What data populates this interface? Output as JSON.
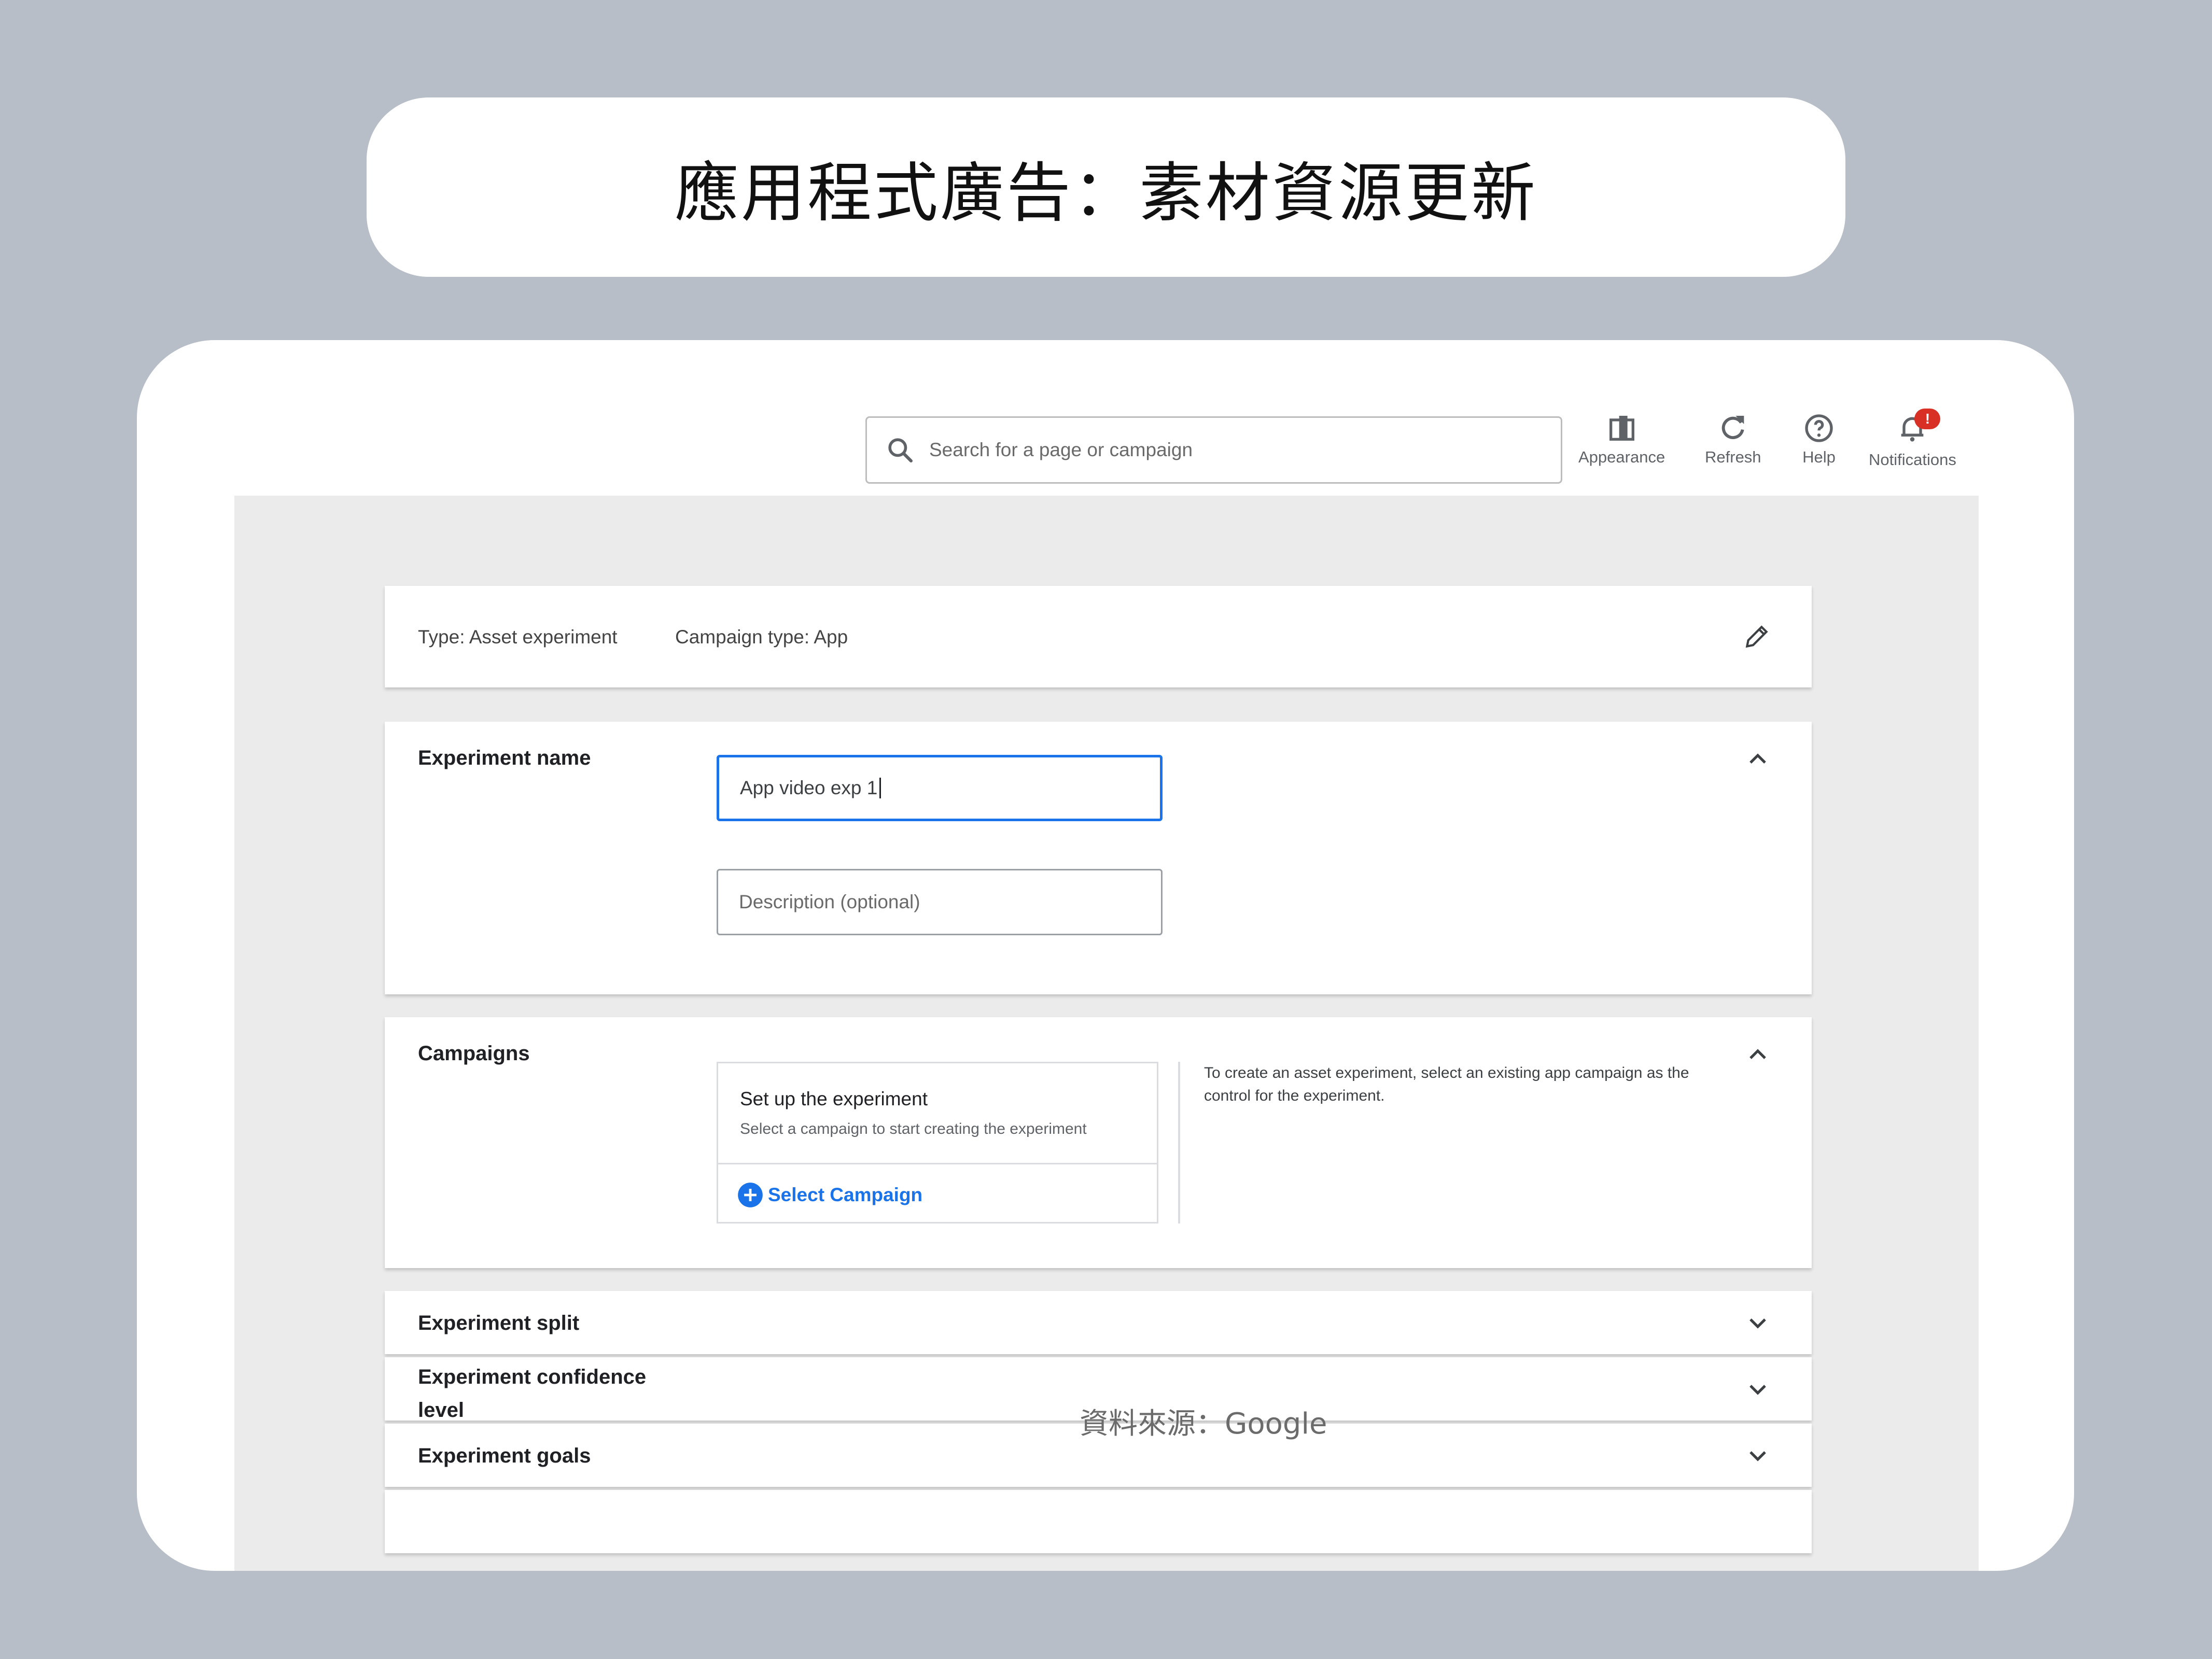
{
  "banner": {
    "title": "應用程式廣告：素材資源更新"
  },
  "header": {
    "search_placeholder": "Search for a page or campaign",
    "toolbar": {
      "appearance": "Appearance",
      "refresh": "Refresh",
      "help": "Help",
      "notifications": "Notifications",
      "notifications_badge": "!"
    }
  },
  "summary": {
    "type": "Type: Asset experiment",
    "campaign_type": "Campaign type: App"
  },
  "experiment_name_section": {
    "label": "Experiment name",
    "name_value": "App video exp 1",
    "description_placeholder": "Description (optional)"
  },
  "campaigns_section": {
    "label": "Campaigns",
    "setup_title": "Set up the experiment",
    "setup_subtitle": "Select a campaign to start creating the experiment",
    "select_button": "Select Campaign",
    "help_text": "To create an asset experiment, select an existing app campaign as the control for the experiment."
  },
  "collapsed_sections": [
    {
      "label": "Experiment split"
    },
    {
      "label": "Experiment confidence level"
    },
    {
      "label": "Experiment goals"
    }
  ],
  "source_caption": "資料來源：Google",
  "colors": {
    "accent": "#1a73e8",
    "badge": "#d93025",
    "background": "#b8bec7"
  }
}
